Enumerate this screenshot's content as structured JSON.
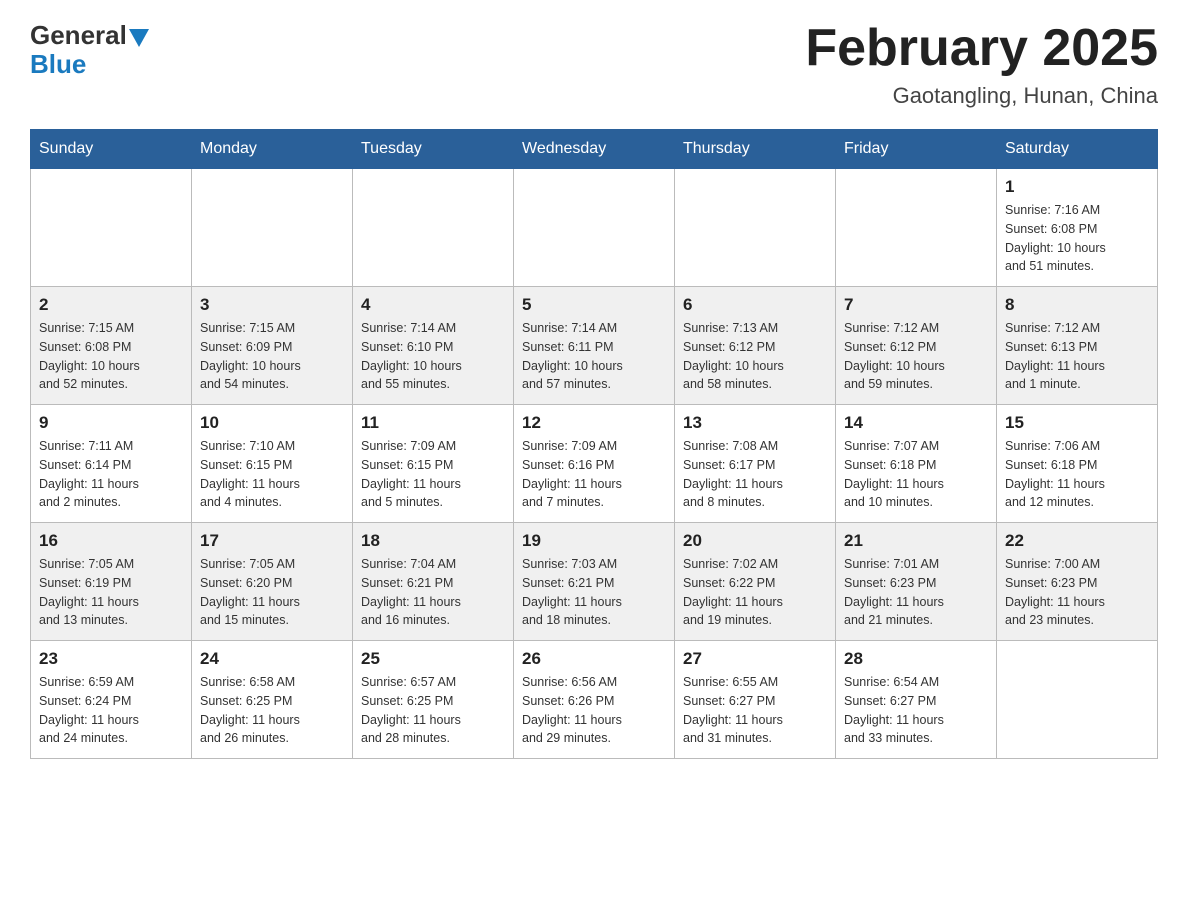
{
  "logo": {
    "general": "General",
    "blue": "Blue"
  },
  "title": "February 2025",
  "location": "Gaotangling, Hunan, China",
  "days_of_week": [
    "Sunday",
    "Monday",
    "Tuesday",
    "Wednesday",
    "Thursday",
    "Friday",
    "Saturday"
  ],
  "weeks": [
    [
      {
        "day": "",
        "info": ""
      },
      {
        "day": "",
        "info": ""
      },
      {
        "day": "",
        "info": ""
      },
      {
        "day": "",
        "info": ""
      },
      {
        "day": "",
        "info": ""
      },
      {
        "day": "",
        "info": ""
      },
      {
        "day": "1",
        "info": "Sunrise: 7:16 AM\nSunset: 6:08 PM\nDaylight: 10 hours\nand 51 minutes."
      }
    ],
    [
      {
        "day": "2",
        "info": "Sunrise: 7:15 AM\nSunset: 6:08 PM\nDaylight: 10 hours\nand 52 minutes."
      },
      {
        "day": "3",
        "info": "Sunrise: 7:15 AM\nSunset: 6:09 PM\nDaylight: 10 hours\nand 54 minutes."
      },
      {
        "day": "4",
        "info": "Sunrise: 7:14 AM\nSunset: 6:10 PM\nDaylight: 10 hours\nand 55 minutes."
      },
      {
        "day": "5",
        "info": "Sunrise: 7:14 AM\nSunset: 6:11 PM\nDaylight: 10 hours\nand 57 minutes."
      },
      {
        "day": "6",
        "info": "Sunrise: 7:13 AM\nSunset: 6:12 PM\nDaylight: 10 hours\nand 58 minutes."
      },
      {
        "day": "7",
        "info": "Sunrise: 7:12 AM\nSunset: 6:12 PM\nDaylight: 10 hours\nand 59 minutes."
      },
      {
        "day": "8",
        "info": "Sunrise: 7:12 AM\nSunset: 6:13 PM\nDaylight: 11 hours\nand 1 minute."
      }
    ],
    [
      {
        "day": "9",
        "info": "Sunrise: 7:11 AM\nSunset: 6:14 PM\nDaylight: 11 hours\nand 2 minutes."
      },
      {
        "day": "10",
        "info": "Sunrise: 7:10 AM\nSunset: 6:15 PM\nDaylight: 11 hours\nand 4 minutes."
      },
      {
        "day": "11",
        "info": "Sunrise: 7:09 AM\nSunset: 6:15 PM\nDaylight: 11 hours\nand 5 minutes."
      },
      {
        "day": "12",
        "info": "Sunrise: 7:09 AM\nSunset: 6:16 PM\nDaylight: 11 hours\nand 7 minutes."
      },
      {
        "day": "13",
        "info": "Sunrise: 7:08 AM\nSunset: 6:17 PM\nDaylight: 11 hours\nand 8 minutes."
      },
      {
        "day": "14",
        "info": "Sunrise: 7:07 AM\nSunset: 6:18 PM\nDaylight: 11 hours\nand 10 minutes."
      },
      {
        "day": "15",
        "info": "Sunrise: 7:06 AM\nSunset: 6:18 PM\nDaylight: 11 hours\nand 12 minutes."
      }
    ],
    [
      {
        "day": "16",
        "info": "Sunrise: 7:05 AM\nSunset: 6:19 PM\nDaylight: 11 hours\nand 13 minutes."
      },
      {
        "day": "17",
        "info": "Sunrise: 7:05 AM\nSunset: 6:20 PM\nDaylight: 11 hours\nand 15 minutes."
      },
      {
        "day": "18",
        "info": "Sunrise: 7:04 AM\nSunset: 6:21 PM\nDaylight: 11 hours\nand 16 minutes."
      },
      {
        "day": "19",
        "info": "Sunrise: 7:03 AM\nSunset: 6:21 PM\nDaylight: 11 hours\nand 18 minutes."
      },
      {
        "day": "20",
        "info": "Sunrise: 7:02 AM\nSunset: 6:22 PM\nDaylight: 11 hours\nand 19 minutes."
      },
      {
        "day": "21",
        "info": "Sunrise: 7:01 AM\nSunset: 6:23 PM\nDaylight: 11 hours\nand 21 minutes."
      },
      {
        "day": "22",
        "info": "Sunrise: 7:00 AM\nSunset: 6:23 PM\nDaylight: 11 hours\nand 23 minutes."
      }
    ],
    [
      {
        "day": "23",
        "info": "Sunrise: 6:59 AM\nSunset: 6:24 PM\nDaylight: 11 hours\nand 24 minutes."
      },
      {
        "day": "24",
        "info": "Sunrise: 6:58 AM\nSunset: 6:25 PM\nDaylight: 11 hours\nand 26 minutes."
      },
      {
        "day": "25",
        "info": "Sunrise: 6:57 AM\nSunset: 6:25 PM\nDaylight: 11 hours\nand 28 minutes."
      },
      {
        "day": "26",
        "info": "Sunrise: 6:56 AM\nSunset: 6:26 PM\nDaylight: 11 hours\nand 29 minutes."
      },
      {
        "day": "27",
        "info": "Sunrise: 6:55 AM\nSunset: 6:27 PM\nDaylight: 11 hours\nand 31 minutes."
      },
      {
        "day": "28",
        "info": "Sunrise: 6:54 AM\nSunset: 6:27 PM\nDaylight: 11 hours\nand 33 minutes."
      },
      {
        "day": "",
        "info": ""
      }
    ]
  ]
}
